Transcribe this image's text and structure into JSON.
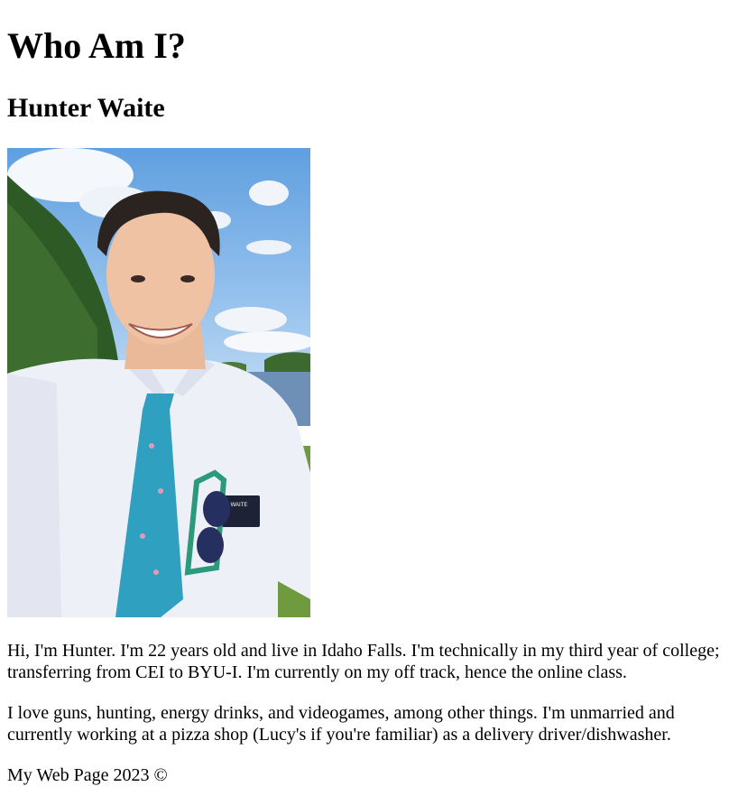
{
  "header": {
    "title": "Who Am I?",
    "name": "Hunter Waite"
  },
  "photo": {
    "name_tag_text": "WAITE"
  },
  "bio": {
    "paragraph1": "Hi, I'm Hunter. I'm 22 years old and live in Idaho Falls. I'm technically in my third year of college; transferring from CEI to BYU-I. I'm currently on my off track, hence the online class.",
    "paragraph2": "I love guns, hunting, energy drinks, and videogames, among other things. I'm unmarried and currently working at a pizza shop (Lucy's if you're familiar) as a delivery driver/dishwasher."
  },
  "footer": {
    "text": "My Web Page 2023 ©"
  },
  "colors": {
    "sky": "#7fb4e6",
    "shirt": "#eef0f8",
    "tie": "#2fa0c0",
    "grass": "#6f9a3e"
  }
}
